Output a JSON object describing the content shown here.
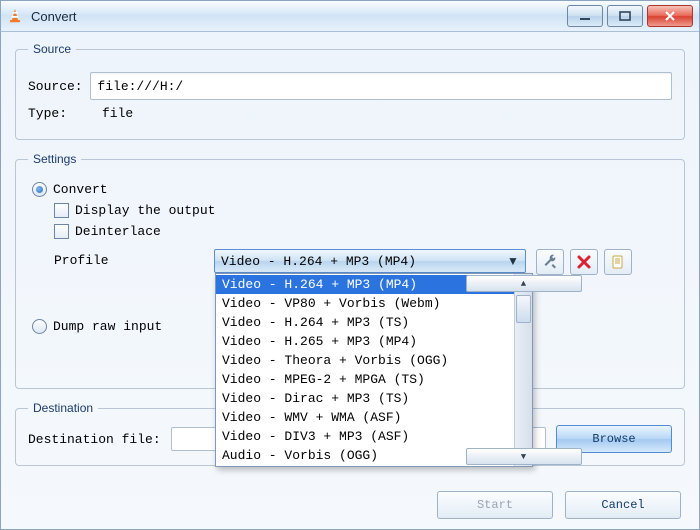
{
  "window": {
    "title": "Convert"
  },
  "source_group": {
    "legend": "Source",
    "source_label": "Source: ",
    "source_value": "file:///H:/",
    "type_label": "Type: ",
    "type_value": "file"
  },
  "settings_group": {
    "legend": "Settings",
    "convert_label": "Convert",
    "display_output_label": "Display the output",
    "deinterlace_label": "Deinterlace",
    "profile_label": "Profile",
    "profile_selected": "Video - H.264 + MP3 (MP4)",
    "profile_options": [
      "Video - H.264 + MP3 (MP4)",
      "Video - VP80 + Vorbis (Webm)",
      "Video - H.264 + MP3 (TS)",
      "Video - H.265 + MP3 (MP4)",
      "Video - Theora + Vorbis (OGG)",
      "Video - MPEG-2 + MPGA (TS)",
      "Video - Dirac + MP3 (TS)",
      "Video - WMV + WMA (ASF)",
      "Video - DIV3 + MP3 (ASF)",
      "Audio - Vorbis (OGG)"
    ],
    "profile_highlight_index": 0,
    "dump_label": "Dump raw input"
  },
  "destination_group": {
    "legend": "Destination",
    "file_label": "Destination file:",
    "browse_label": "Browse"
  },
  "buttons": {
    "start": "Start",
    "cancel": "Cancel"
  }
}
